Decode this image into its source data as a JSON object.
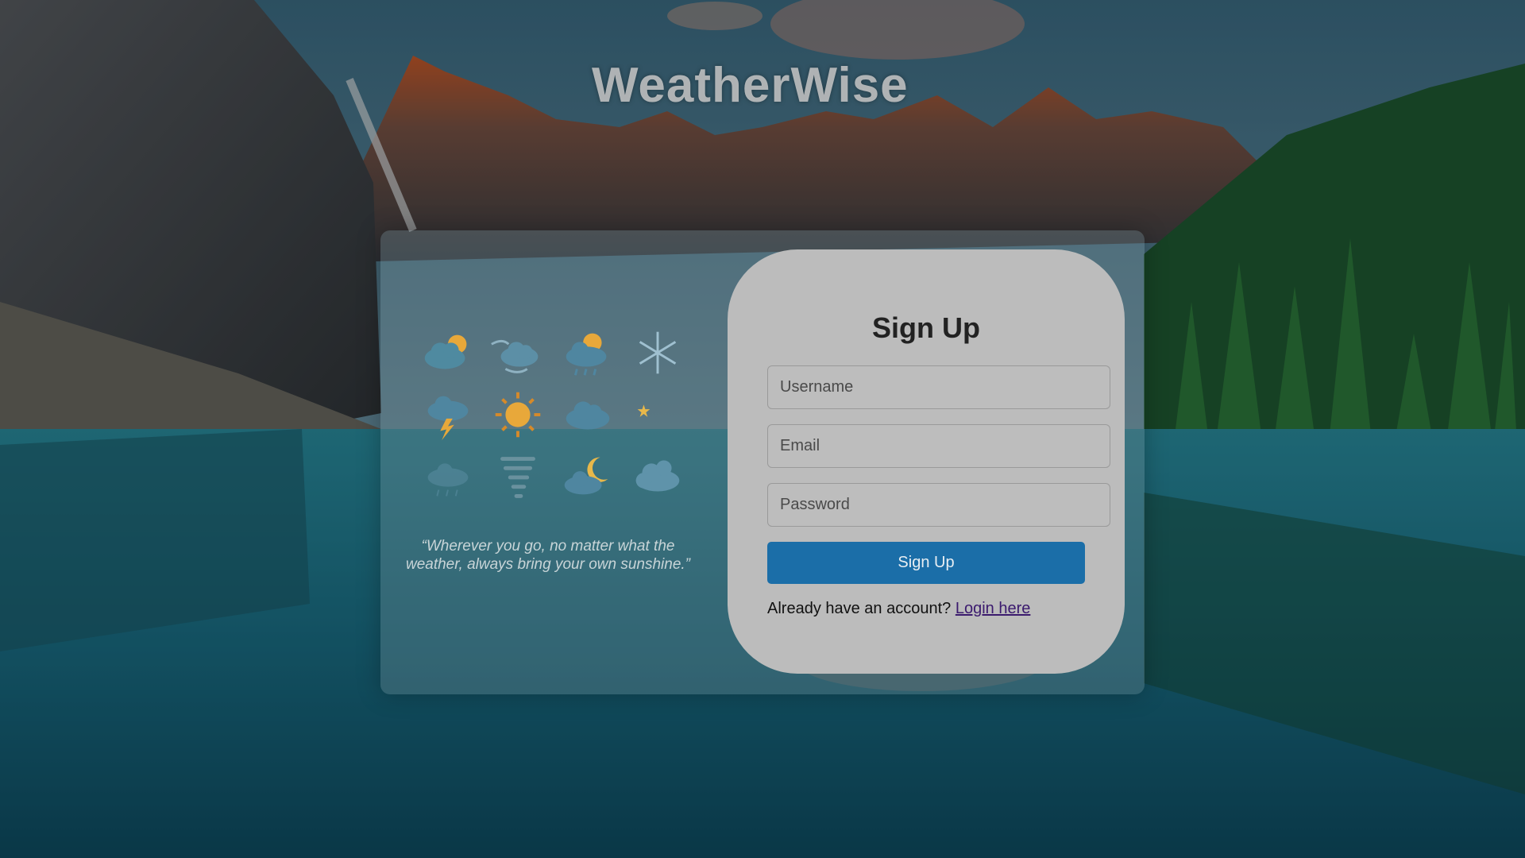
{
  "app": {
    "title": "WeatherWise"
  },
  "colors": {
    "card_bg": "#bcbcbc",
    "button_bg": "#1b6ea8",
    "link": "#3b1a6e",
    "title_text": "#c8c8c8"
  },
  "decor": {
    "icons": [
      "cloud-sun-icon",
      "wind-cloud-icon",
      "rain-sun-icon",
      "snowflake-icon",
      "thunderstorm-icon",
      "sun-icon",
      "cloud-icon",
      "moon-stars-icon",
      "drizzle-cloud-icon",
      "tornado-icon",
      "cloud-moon-icon",
      "hail-cloud-icon"
    ],
    "quote": "“Wherever you go, no matter what the weather, always bring your own sunshine.”"
  },
  "signup": {
    "title": "Sign Up",
    "username_placeholder": "Username",
    "email_placeholder": "Email",
    "password_placeholder": "Password",
    "submit_label": "Sign Up",
    "login_prompt": "Already have an account?",
    "login_link": "Login here"
  }
}
